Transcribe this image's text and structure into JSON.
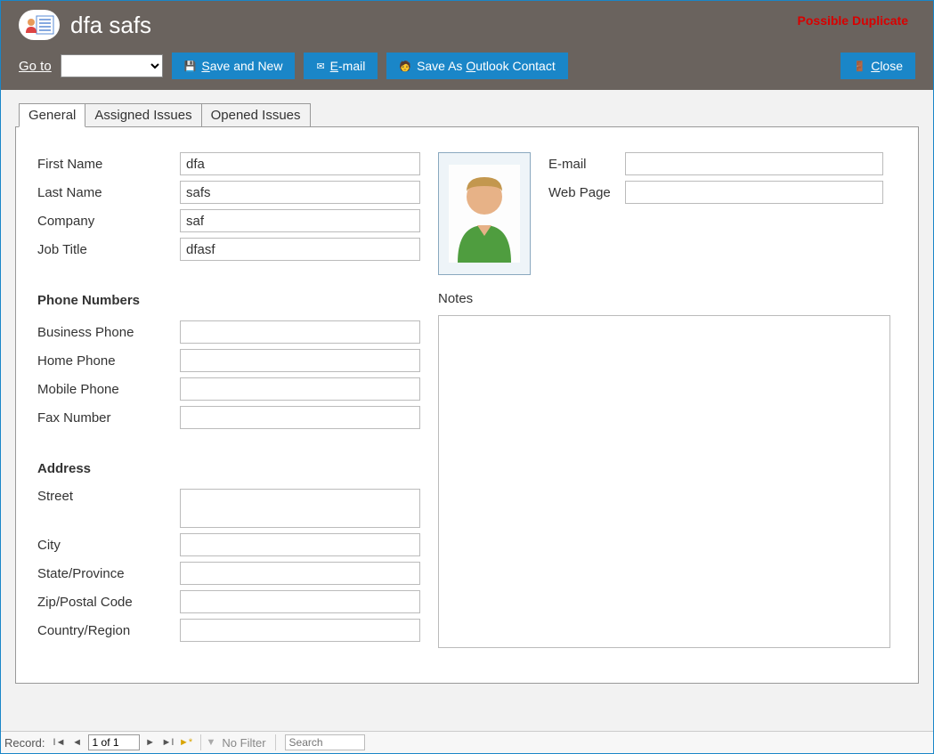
{
  "header": {
    "title": "dfa safs",
    "duplicate_warning": "Possible Duplicate",
    "goto_label": "Go to",
    "buttons": {
      "save_new_pre": "S",
      "save_new_rest": "ave and New",
      "email_pre": "E",
      "email_rest": "-mail",
      "save_outlook_pre1": "Save As ",
      "save_outlook_u": "O",
      "save_outlook_rest": "utlook Contact",
      "close_pre": "C",
      "close_rest": "lose"
    }
  },
  "tabs": {
    "general": "General",
    "assigned": "Assigned Issues",
    "opened": "Opened Issues"
  },
  "labels": {
    "first_name": "First Name",
    "last_name": "Last Name",
    "company": "Company",
    "job_title": "Job Title",
    "phone_section": "Phone Numbers",
    "business_phone": "Business Phone",
    "home_phone": "Home Phone",
    "mobile_phone": "Mobile Phone",
    "fax": "Fax Number",
    "address_section": "Address",
    "street": "Street",
    "city": "City",
    "state": "State/Province",
    "zip": "Zip/Postal Code",
    "country": "Country/Region",
    "email": "E-mail",
    "webpage": "Web Page",
    "notes": "Notes"
  },
  "values": {
    "first_name": "dfa",
    "last_name": "safs",
    "company": "saf",
    "job_title": "dfasf",
    "business_phone": "",
    "home_phone": "",
    "mobile_phone": "",
    "fax": "",
    "street": "",
    "city": "",
    "state": "",
    "zip": "",
    "country": "",
    "email": "",
    "webpage": "",
    "notes": ""
  },
  "statusbar": {
    "record_label": "Record:",
    "record_position": "1 of 1",
    "no_filter": "No Filter",
    "search_placeholder": "Search"
  }
}
